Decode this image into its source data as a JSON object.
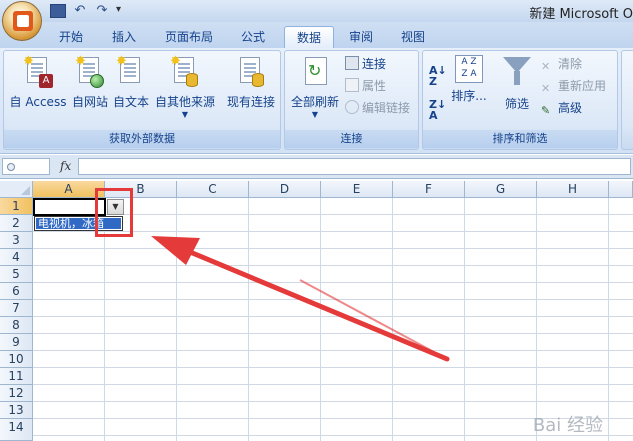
{
  "title": {
    "text": "新建 Microsoft O"
  },
  "tabs": [
    {
      "label": "开始"
    },
    {
      "label": "插入"
    },
    {
      "label": "页面布局"
    },
    {
      "label": "公式"
    },
    {
      "label": "数据",
      "active": true
    },
    {
      "label": "审阅"
    },
    {
      "label": "视图"
    }
  ],
  "ribbon": {
    "external_data": {
      "buttons": [
        "自 Access",
        "自网站",
        "自文本",
        "自其他来源",
        "现有连接"
      ],
      "group_label": "获取外部数据"
    },
    "connections": {
      "refresh_all": "全部刷新",
      "connect": "连接",
      "properties": "属性",
      "edit_links": "编辑链接",
      "group_label": "连接"
    },
    "sort_filter": {
      "sort": "排序...",
      "filter": "筛选",
      "clear": "清除",
      "reapply": "重新应用",
      "advanced": "高级",
      "group_label": "排序和筛选"
    }
  },
  "formula_bar": {
    "fx": "fx",
    "value": ""
  },
  "sheet": {
    "columns": [
      "A",
      "B",
      "C",
      "D",
      "E",
      "F",
      "G",
      "H"
    ],
    "rows": [
      "1",
      "2",
      "3",
      "4",
      "5",
      "6",
      "7",
      "8",
      "9",
      "10",
      "11",
      "12",
      "13",
      "14"
    ],
    "active_cell": "A1",
    "dropdown_item": "电视机，冰箱"
  },
  "watermark": "Bai 经验",
  "colors": {
    "annotation": "#e53a3a",
    "selection": "#316ac5"
  }
}
